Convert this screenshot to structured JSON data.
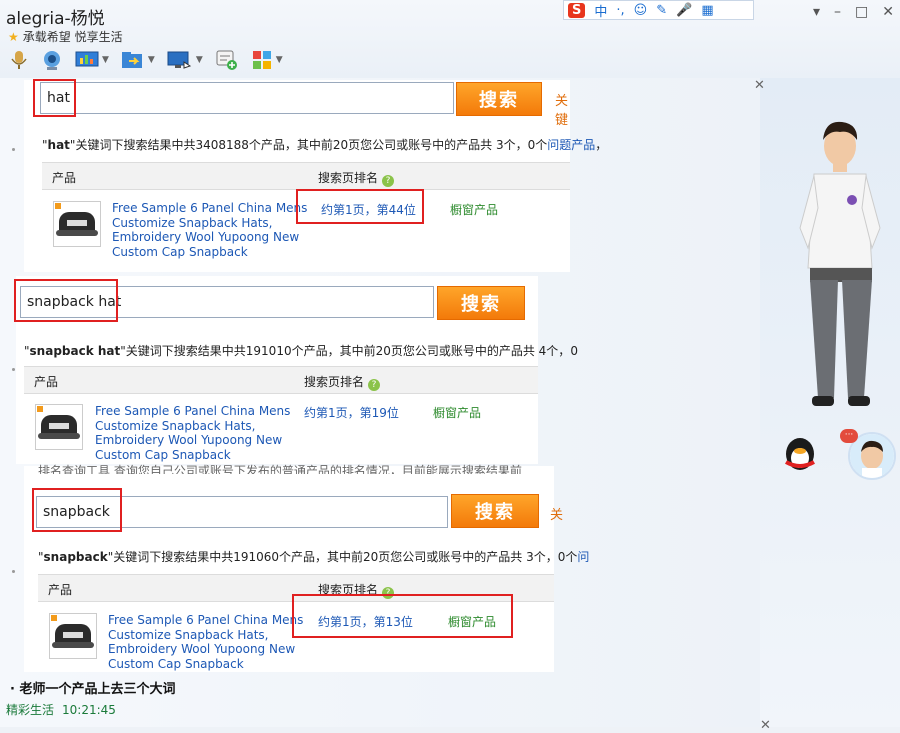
{
  "window": {
    "title": "alegria-杨悦",
    "signature": "承载希望 悦享生活",
    "controls": [
      "▾",
      "–",
      "□",
      "✕"
    ]
  },
  "ime_bar": {
    "logo": "S",
    "mode": "中",
    "items": [
      "·,",
      "☺",
      "✎",
      "🎤",
      "▦"
    ]
  },
  "toolbar": {
    "items": [
      {
        "icon": "microphone-icon"
      },
      {
        "icon": "webcam-icon"
      },
      {
        "icon": "screen-share-icon"
      },
      {
        "icon": "file-transfer-icon"
      },
      {
        "icon": "remote-desktop-icon"
      },
      {
        "icon": "add-app-icon"
      },
      {
        "icon": "app-grid-icon"
      }
    ]
  },
  "shots": [
    {
      "query": "hat",
      "button": "搜索",
      "extra_link": "关键",
      "summary_keyword": "hat",
      "summary_text": "关键词下搜索结果中共3408188个产品，其中前20页您公司或账号中的产品共 3个，0个",
      "summary_link": "问题产品",
      "summary_tail": "，",
      "col_product": "产品",
      "col_rank": "搜索页排名",
      "product_name": "Free Sample 6 Panel China Mens Customize Snapback Hats, Embroidery Wool Yupoong New Custom Cap Snapback",
      "rank": "约第1页，第44位",
      "window_product": "橱窗产品"
    },
    {
      "query": "snapback hat",
      "button": "搜索",
      "extra_link": "",
      "summary_keyword": "snapback hat",
      "summary_text": "关键词下搜索结果中共191010个产品，其中前20页您公司或账号中的产品共 4个，",
      "summary_link": "",
      "summary_tail": "0",
      "col_product": "产品",
      "col_rank": "搜索页排名",
      "product_name": "Free Sample 6 Panel China Mens Customize Snapback Hats, Embroidery Wool Yupoong New Custom Cap Snapback",
      "rank": "约第1页，第19位",
      "window_product": "橱窗产品"
    },
    {
      "top_clip": "排名查询工具    查询您自己公司或账号下发布的普通产品的排名情况，目前能展示搜索结果前",
      "query": "snapback",
      "button": "搜索",
      "extra_link": "关",
      "summary_keyword": "snapback",
      "summary_text": "关键词下搜索结果中共191060个产品，其中前20页您公司或账号中的产品共 3个，0个",
      "summary_link": "问",
      "summary_tail": "",
      "col_product": "产品",
      "col_rank": "搜索页排名",
      "product_name": "Free Sample 6 Panel China Mens Customize Snapback Hats, Embroidery Wool Yupoong New Custom Cap Snapback",
      "rank": "约第1页，第13位",
      "window_product": "橱窗产品"
    }
  ],
  "chat": {
    "message": "老师一个产品上去三个大词",
    "sender": "精彩生活",
    "time": "10:21:45"
  },
  "sidebar": {
    "close": "✕",
    "notif_badge": "···"
  }
}
